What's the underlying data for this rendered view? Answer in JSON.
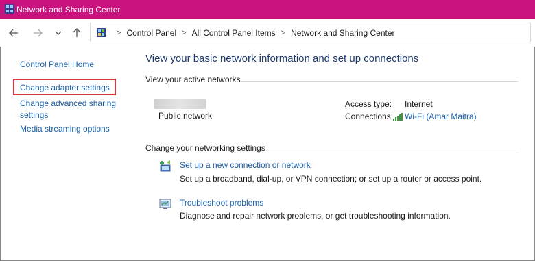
{
  "window": {
    "title": "Network and Sharing Center",
    "accent": "#c8127e"
  },
  "nav": {
    "back_icon": "back-arrow",
    "forward_icon": "forward-arrow",
    "recent_icon": "chevron-down",
    "up_icon": "up-arrow",
    "breadcrumbs": [
      "Control Panel",
      "All Control Panel Items",
      "Network and Sharing Center"
    ]
  },
  "sidebar": {
    "home": "Control Panel Home",
    "items": [
      "Change adapter settings",
      "Change advanced sharing settings",
      "Media streaming options"
    ],
    "highlight_color": "#d9363e"
  },
  "main": {
    "title": "View your basic network information and set up connections",
    "active_networks": {
      "heading": "View your active networks",
      "network_type": "Public network",
      "access_type_label": "Access type:",
      "access_type_value": "Internet",
      "connections_label": "Connections:",
      "connections_value": "Wi-Fi (Amar Maitra)"
    },
    "settings": {
      "heading": "Change your networking settings",
      "tasks": [
        {
          "link": "Set up a new connection or network",
          "description": "Set up a broadband, dial-up, or VPN connection; or set up a router or access point.",
          "icon": "new-connection-icon"
        },
        {
          "link": "Troubleshoot problems",
          "description": "Diagnose and repair network problems, or get troubleshooting information.",
          "icon": "troubleshoot-icon"
        }
      ]
    }
  },
  "colors": {
    "link": "#1a5fa8",
    "title": "#1e3a6e"
  }
}
